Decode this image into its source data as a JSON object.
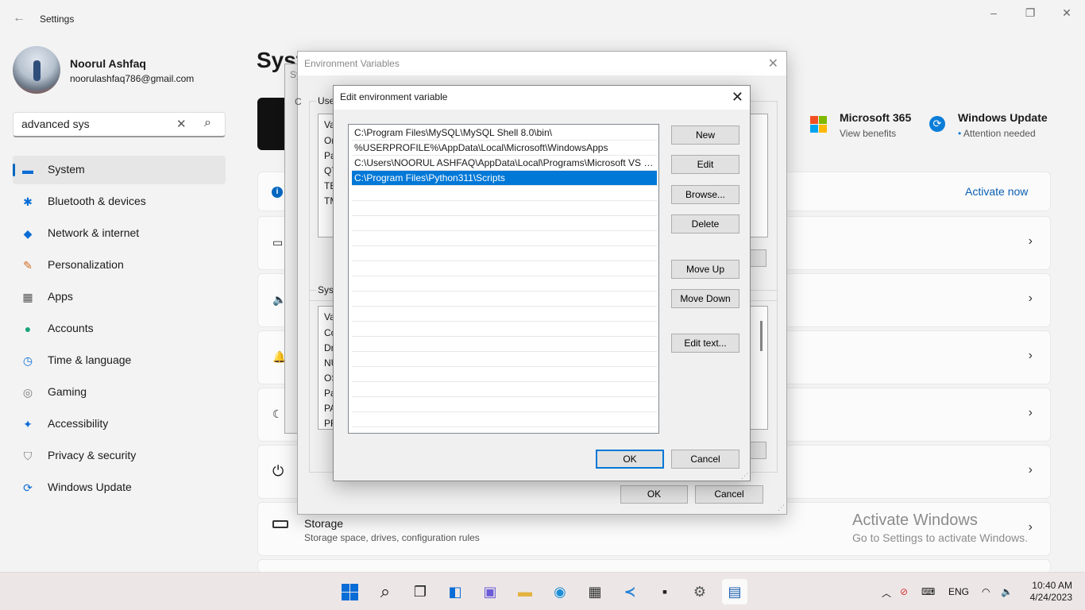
{
  "window": {
    "title": "Settings",
    "minimize": "–",
    "maximize": "❐",
    "close": "✕"
  },
  "user": {
    "name": "Noorul Ashfaq",
    "email": "noorulashfaq786@gmail.com"
  },
  "search": {
    "value": "advanced sys"
  },
  "nav": [
    {
      "label": "System",
      "icon": "display-icon",
      "selected": true
    },
    {
      "label": "Bluetooth & devices",
      "icon": "bluetooth-icon"
    },
    {
      "label": "Network & internet",
      "icon": "wifi-icon"
    },
    {
      "label": "Personalization",
      "icon": "brush-icon"
    },
    {
      "label": "Apps",
      "icon": "apps-icon"
    },
    {
      "label": "Accounts",
      "icon": "person-icon"
    },
    {
      "label": "Time & language",
      "icon": "clock-globe-icon"
    },
    {
      "label": "Gaming",
      "icon": "gamepad-icon"
    },
    {
      "label": "Accessibility",
      "icon": "accessibility-icon"
    },
    {
      "label": "Privacy & security",
      "icon": "shield-icon"
    },
    {
      "label": "Windows Update",
      "icon": "update-icon"
    }
  ],
  "main": {
    "title": "Syst",
    "microsoft365": {
      "title": "Microsoft 365",
      "subtitle": "View benefits"
    },
    "windows_update": {
      "title": "Windows Update",
      "subtitle": "Attention needed"
    },
    "activate_now": "Activate now",
    "storage": {
      "title": "Storage",
      "subtitle": "Storage space, drives, configuration rules"
    },
    "watermark": {
      "title": "Activate Windows",
      "subtitle": "Go to Settings to activate Windows."
    }
  },
  "system_properties": {
    "title_fragment": "Sy"
  },
  "env_dialog": {
    "title": "Environment Variables",
    "user_group_fragment": "User",
    "user_col_fragment": "Va",
    "user_rows_fragment": [
      "On",
      "Pa",
      "QT",
      "TE",
      "TM"
    ],
    "system_group_fragment": "Syste",
    "system_col_fragment": "Va",
    "system_rows_fragment": [
      "Co",
      "Dr",
      "NU",
      "OS",
      "Pa",
      "PA",
      "PR"
    ],
    "ok": "OK",
    "cancel": "Cancel",
    "group_fragment": "C"
  },
  "edit_dialog": {
    "title": "Edit environment variable",
    "paths": [
      "C:\\Program Files\\MySQL\\MySQL Shell 8.0\\bin\\",
      "%USERPROFILE%\\AppData\\Local\\Microsoft\\WindowsApps",
      "C:\\Users\\NOORUL ASHFAQ\\AppData\\Local\\Programs\\Microsoft VS C...",
      "C:\\Program Files\\Python311\\Scripts"
    ],
    "selected_index": 3,
    "buttons": {
      "new": "New",
      "edit": "Edit",
      "browse": "Browse...",
      "delete": "Delete",
      "move_up": "Move Up",
      "move_down": "Move Down",
      "edit_text": "Edit text..."
    },
    "ok": "OK",
    "cancel": "Cancel"
  },
  "taskbar": {
    "language": "ENG",
    "time": "10:40 AM",
    "date": "4/24/2023"
  },
  "colors": {
    "accent": "#0067c0",
    "selection": "#0078d7"
  }
}
